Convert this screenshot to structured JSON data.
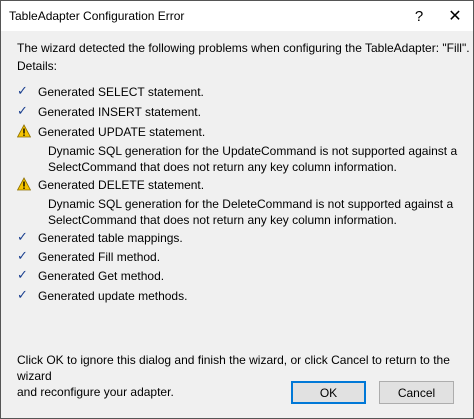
{
  "window": {
    "title": "TableAdapter Configuration Error",
    "help_label": "?",
    "close_label": "✕"
  },
  "intro": "The wizard detected the following problems when configuring the TableAdapter: \"Fill\".",
  "details_label": "Details:",
  "items": [
    {
      "status": "check",
      "label": "Generated SELECT statement."
    },
    {
      "status": "check",
      "label": "Generated INSERT statement."
    },
    {
      "status": "warning",
      "label": "Generated UPDATE statement.",
      "message_line1": "Dynamic SQL generation for the UpdateCommand is not supported against a",
      "message_line2": "SelectCommand that does not return any key column information."
    },
    {
      "status": "warning",
      "label": "Generated DELETE statement.",
      "message_line1": "Dynamic SQL generation for the DeleteCommand is not supported against a",
      "message_line2": "SelectCommand that does not return any key column information."
    },
    {
      "status": "check",
      "label": "Generated table mappings."
    },
    {
      "status": "check",
      "label": "Generated Fill method."
    },
    {
      "status": "check",
      "label": "Generated Get method."
    },
    {
      "status": "check",
      "label": "Generated update methods."
    }
  ],
  "footer": {
    "line1": "Click OK to ignore this dialog and finish the wizard, or click Cancel to return to the wizard",
    "line2": "and reconfigure your adapter."
  },
  "buttons": {
    "ok_label": "OK",
    "cancel_label": "Cancel"
  },
  "colors": {
    "check": "#1a3f8f",
    "warning": "#f5c400",
    "default_button_border": "#0078d7"
  }
}
